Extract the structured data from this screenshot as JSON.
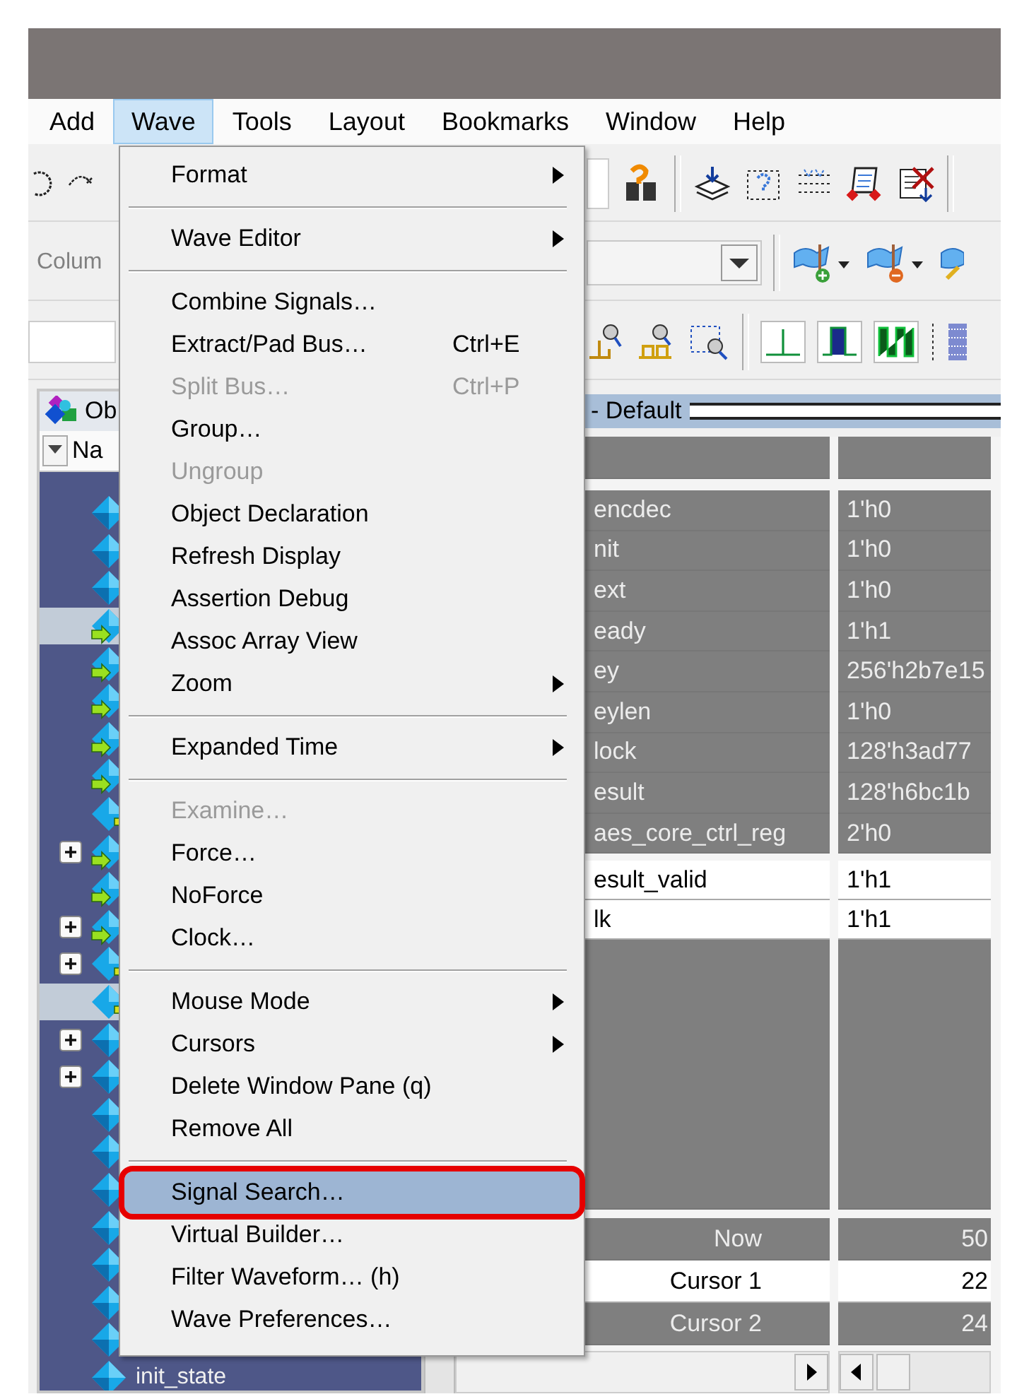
{
  "menu_bar": [
    {
      "label": "Add",
      "selected": false
    },
    {
      "label": "Wave",
      "selected": true
    },
    {
      "label": "Tools",
      "selected": false
    },
    {
      "label": "Layout",
      "selected": false
    },
    {
      "label": "Bookmarks",
      "selected": false
    },
    {
      "label": "Window",
      "selected": false
    },
    {
      "label": "Help",
      "selected": false
    }
  ],
  "toolbar": {
    "columns_label": "Colum"
  },
  "objects_pane": {
    "title": "Ob",
    "column_1": "Na",
    "rows": [
      {
        "kind": "signal",
        "expandable": false,
        "selected": false
      },
      {
        "kind": "signal",
        "expandable": false,
        "selected": false
      },
      {
        "kind": "signal",
        "expandable": false,
        "selected": false
      },
      {
        "kind": "port",
        "expandable": false,
        "selected": true
      },
      {
        "kind": "port",
        "expandable": false,
        "selected": false
      },
      {
        "kind": "port",
        "expandable": false,
        "selected": false
      },
      {
        "kind": "port",
        "expandable": false,
        "selected": false
      },
      {
        "kind": "port",
        "expandable": false,
        "selected": false
      },
      {
        "kind": "net",
        "expandable": false,
        "selected": false
      },
      {
        "kind": "port",
        "expandable": true,
        "selected": false
      },
      {
        "kind": "port",
        "expandable": false,
        "selected": false
      },
      {
        "kind": "port",
        "expandable": true,
        "selected": false
      },
      {
        "kind": "net",
        "expandable": true,
        "selected": false
      },
      {
        "kind": "net",
        "expandable": false,
        "selected": true
      },
      {
        "kind": "signal",
        "expandable": true,
        "selected": false
      },
      {
        "kind": "signal",
        "expandable": true,
        "selected": false
      },
      {
        "kind": "signal",
        "expandable": false,
        "selected": false
      },
      {
        "kind": "signal",
        "expandable": false,
        "selected": false
      },
      {
        "kind": "signal",
        "expandable": false,
        "selected": false
      },
      {
        "kind": "signal",
        "expandable": false,
        "selected": false
      },
      {
        "kind": "signal",
        "expandable": false,
        "selected": false
      },
      {
        "kind": "signal",
        "expandable": false,
        "selected": false
      },
      {
        "kind": "signal",
        "expandable": false,
        "selected": false
      },
      {
        "kind": "signal",
        "expandable": false,
        "selected": false,
        "name": "init_state"
      }
    ]
  },
  "wave_pane": {
    "title": "- Default",
    "rows": [
      {
        "name": "encdec",
        "value": "1'h0",
        "selected": false
      },
      {
        "name": "nit",
        "value": "1'h0",
        "selected": false
      },
      {
        "name": "ext",
        "value": "1'h0",
        "selected": false
      },
      {
        "name": "eady",
        "value": "1'h1",
        "selected": false
      },
      {
        "name": "ey",
        "value": "256'h2b7e15",
        "selected": false
      },
      {
        "name": "eylen",
        "value": "1'h0",
        "selected": false
      },
      {
        "name": "lock",
        "value": "128'h3ad77",
        "selected": false
      },
      {
        "name": "esult",
        "value": "128'h6bc1b",
        "selected": false
      },
      {
        "name": "aes_core_ctrl_reg",
        "value": "2'h0",
        "selected": false
      },
      {
        "name": "esult_valid",
        "value": "1'h1",
        "selected": true
      },
      {
        "name": "lk",
        "value": "1'h1",
        "selected": true
      }
    ],
    "cursors": [
      {
        "label": "Now",
        "value": "50",
        "selected": false
      },
      {
        "label": "Cursor 1",
        "value": "22",
        "selected": true
      },
      {
        "label": "Cursor 2",
        "value": "24",
        "selected": false
      }
    ]
  },
  "wave_menu": {
    "items": [
      {
        "kind": "item",
        "label": "Format",
        "submenu": true,
        "disabled": false,
        "selected": false,
        "outlined": false
      },
      {
        "kind": "separator"
      },
      {
        "kind": "item",
        "label": "Wave Editor",
        "submenu": true,
        "disabled": false,
        "selected": false,
        "outlined": false
      },
      {
        "kind": "separator"
      },
      {
        "kind": "item",
        "label": "Combine Signals…",
        "submenu": false,
        "disabled": false,
        "selected": false,
        "outlined": false
      },
      {
        "kind": "item",
        "label": "Extract/Pad Bus…",
        "shortcut": "Ctrl+E",
        "submenu": false,
        "disabled": false,
        "selected": false,
        "outlined": false
      },
      {
        "kind": "item",
        "label": "Split Bus…",
        "shortcut": "Ctrl+P",
        "submenu": false,
        "disabled": true,
        "selected": false,
        "outlined": false
      },
      {
        "kind": "item",
        "label": "Group…",
        "submenu": false,
        "disabled": false,
        "selected": false,
        "outlined": false
      },
      {
        "kind": "item",
        "label": "Ungroup",
        "submenu": false,
        "disabled": true,
        "selected": false,
        "outlined": false
      },
      {
        "kind": "item",
        "label": "Object Declaration",
        "submenu": false,
        "disabled": false,
        "selected": false,
        "outlined": false
      },
      {
        "kind": "item",
        "label": "Refresh Display",
        "submenu": false,
        "disabled": false,
        "selected": false,
        "outlined": false
      },
      {
        "kind": "item",
        "label": "Assertion Debug",
        "submenu": false,
        "disabled": false,
        "selected": false,
        "outlined": false
      },
      {
        "kind": "item",
        "label": "Assoc Array View",
        "submenu": false,
        "disabled": false,
        "selected": false,
        "outlined": false
      },
      {
        "kind": "item",
        "label": "Zoom",
        "submenu": true,
        "disabled": false,
        "selected": false,
        "outlined": false
      },
      {
        "kind": "separator"
      },
      {
        "kind": "item",
        "label": "Expanded Time",
        "submenu": true,
        "disabled": false,
        "selected": false,
        "outlined": false
      },
      {
        "kind": "separator"
      },
      {
        "kind": "item",
        "label": "Examine…",
        "submenu": false,
        "disabled": true,
        "selected": false,
        "outlined": false
      },
      {
        "kind": "item",
        "label": "Force…",
        "submenu": false,
        "disabled": false,
        "selected": false,
        "outlined": false
      },
      {
        "kind": "item",
        "label": "NoForce",
        "submenu": false,
        "disabled": false,
        "selected": false,
        "outlined": false
      },
      {
        "kind": "item",
        "label": "Clock…",
        "submenu": false,
        "disabled": false,
        "selected": false,
        "outlined": false
      },
      {
        "kind": "separator"
      },
      {
        "kind": "item",
        "label": "Mouse Mode",
        "submenu": true,
        "disabled": false,
        "selected": false,
        "outlined": false
      },
      {
        "kind": "item",
        "label": "Cursors",
        "submenu": true,
        "disabled": false,
        "selected": false,
        "outlined": false
      },
      {
        "kind": "item",
        "label": "Delete Window Pane (q)",
        "submenu": false,
        "disabled": false,
        "selected": false,
        "outlined": false
      },
      {
        "kind": "item",
        "label": "Remove All",
        "submenu": false,
        "disabled": false,
        "selected": false,
        "outlined": false
      },
      {
        "kind": "separator"
      },
      {
        "kind": "item",
        "label": "Signal Search…",
        "submenu": false,
        "disabled": false,
        "selected": true,
        "outlined": true
      },
      {
        "kind": "item",
        "label": "Virtual Builder…",
        "submenu": false,
        "disabled": false,
        "selected": false,
        "outlined": false
      },
      {
        "kind": "item",
        "label": "Filter Waveform… (h)",
        "submenu": false,
        "disabled": false,
        "selected": false,
        "outlined": false
      },
      {
        "kind": "item",
        "label": "Wave Preferences…",
        "submenu": false,
        "disabled": false,
        "selected": false,
        "outlined": false
      }
    ]
  }
}
